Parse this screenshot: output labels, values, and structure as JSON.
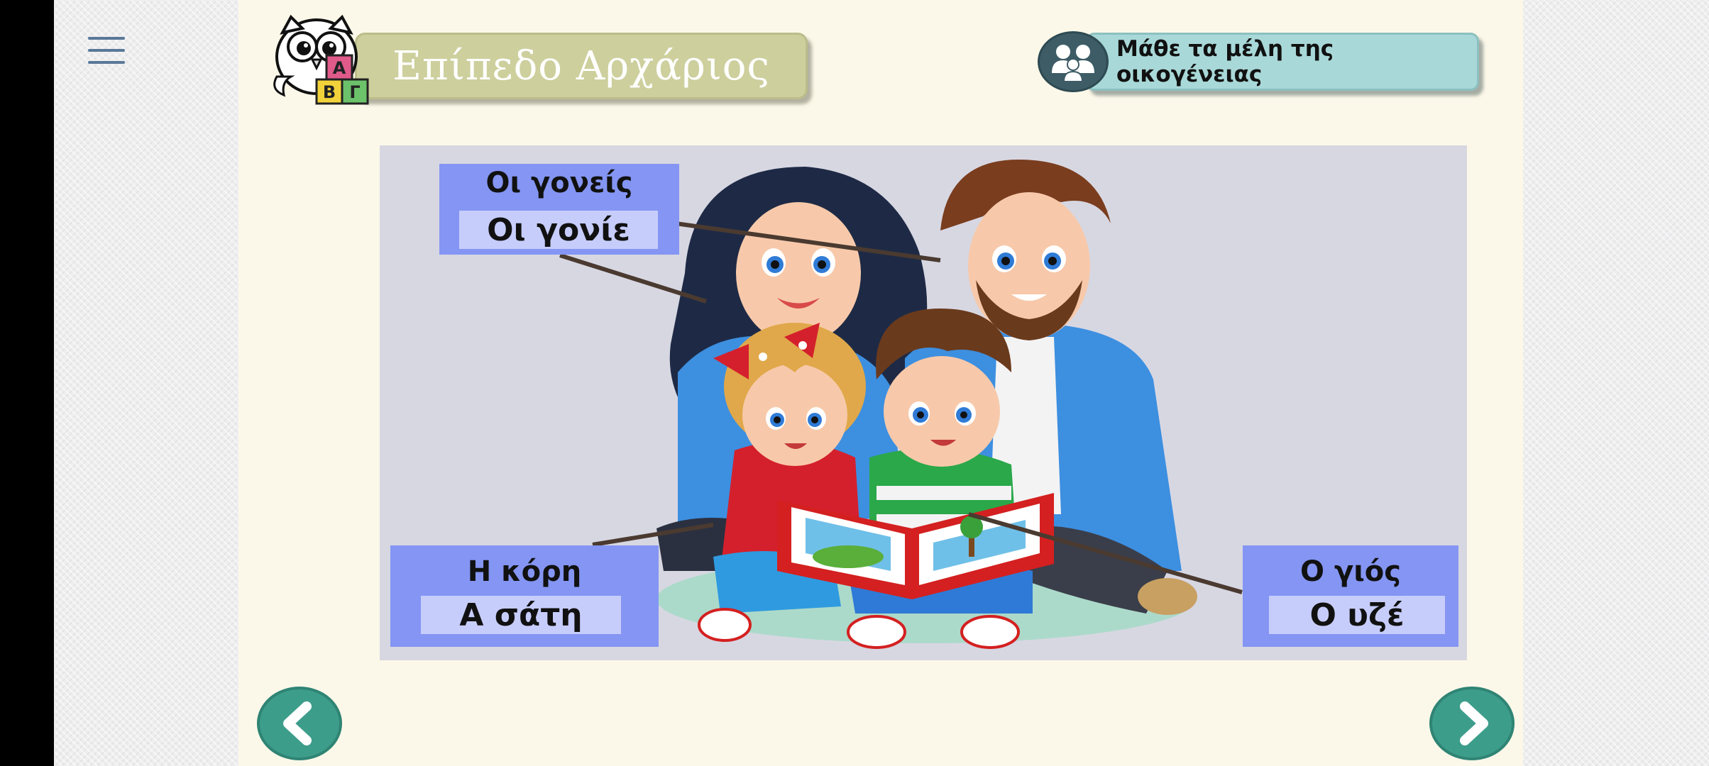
{
  "header": {
    "level_title": "Επίπεδο Αρχάριος",
    "family_button_label": "Μάθε τα μέλη της οικογένειας",
    "logo_letters": [
      "Α",
      "Β",
      "Γ"
    ]
  },
  "labels": {
    "parents": {
      "title": "Οι γονείς",
      "scrambled": "Οι γονίε"
    },
    "daughter": {
      "title": "Η κόρη",
      "scrambled": "Α σάτη"
    },
    "son": {
      "title": "Ο γιός",
      "scrambled": "Ο υζέ"
    }
  },
  "icons": {
    "menu": "hamburger-menu-icon",
    "family": "family-group-icon",
    "prev": "chevron-left-icon",
    "next": "chevron-right-icon"
  },
  "colors": {
    "panel": "#fcf8e9",
    "title_pill": "#cdcf9d",
    "family_button": "#a9d8d8",
    "label_box": "#8495f3",
    "label_inner": "#c7cdfb",
    "nav_button": "#3d9d8b"
  }
}
